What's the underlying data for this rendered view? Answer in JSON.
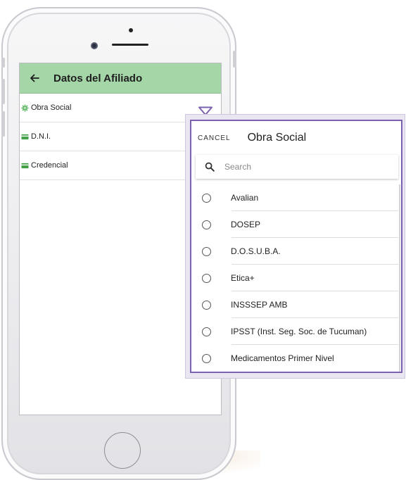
{
  "appbar": {
    "title": "Datos del Afiliado"
  },
  "fields": [
    {
      "label": "Obra Social",
      "icon": "gear-icon",
      "icon_color": "#66bb6a"
    },
    {
      "label": "D.N.I.",
      "icon": "id-card-icon",
      "icon_color": "#43a047"
    },
    {
      "label": "Credencial",
      "icon": "id-card-icon",
      "icon_color": "#43a047"
    }
  ],
  "dialog": {
    "cancel_label": "CANCEL",
    "title": "Obra Social",
    "search_placeholder": "Search",
    "options": [
      {
        "label": "Avalian",
        "selected": false
      },
      {
        "label": "DOSEP",
        "selected": false
      },
      {
        "label": "D.O.S.U.B.A.",
        "selected": false
      },
      {
        "label": "Etica+",
        "selected": false
      },
      {
        "label": "INSSSEP AMB",
        "selected": false
      },
      {
        "label": "IPSST (Inst. Seg. Soc. de Tucuman)",
        "selected": false
      },
      {
        "label": "Medicamentos Primer Nivel",
        "selected": false
      }
    ]
  },
  "colors": {
    "appbar_bg": "#a5d6a7",
    "dialog_border": "#7b62b0",
    "dropdown_arrow": "#7b62b0"
  }
}
